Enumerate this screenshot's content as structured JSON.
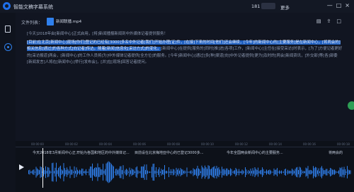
{
  "app": {
    "title": "智能文稿字幕系统",
    "phone": "181",
    "more": "更多"
  },
  "window_icons": [
    "—",
    "□",
    "×"
  ],
  "file": {
    "label": "文件列表：",
    "name": "新闻联播.mp4"
  },
  "transcript": [
    "[今天]2018年由[新闻中心]正式启用，[将]新闻播报新闻到中外媒体记者提供服务！",
    "[目前]在北京[新闻中心]现场[你们]登记的已经有[3000]多名中外记者[我们]开始办理[证]件，[在接]下来的时间[他们]还会继续，[今年]的新闻中心的[主要服务]是在新闻中心，[将两会的]相关信息[通过]的各种方式[向记者]传达。随着[新闻]信息化[采访方式]的变化，[新闻中心]在提供[服务的]同时[推]进[各项]工作，[新闻中心]主任在[接受采访]时表示，[为了]方便记者更好的[采访报道]两会，[新闻中心]的工作人员将[为]中外媒体记者提供[全方位]的服务。[今年]新闻中心[通过]多[种]渠道[向]中外记者提供[更为]及时的[两会]新闻资讯，[外交部]等[各]部委[新闻发言]人将在[新闻中心]举行[发布会]，[并]在[现场]回答记者提问。"
  ],
  "highlight_count": 1,
  "timeline": {
    "ticks": [
      "00:00:00",
      "00:00:02",
      "00:00:04",
      "00:00:06",
      "00:00:08",
      "00:00:10",
      "00:00:12",
      "00:00:14",
      "00:00:16",
      "00:00:18"
    ],
    "subtitles": [
      "今天2018年3月新闻中心正...",
      "开始为各国和地区的中外媒体记...",
      "目前设在北京梅地亚中心的已登记3000多...",
      "今年全国两会新闻中心的主要服务...",
      "将两会的"
    ]
  },
  "colors": {
    "accent": "#2f80ed",
    "highlight": "#2060c0",
    "wave": "#2f80ed",
    "float": "#2e9e55"
  }
}
